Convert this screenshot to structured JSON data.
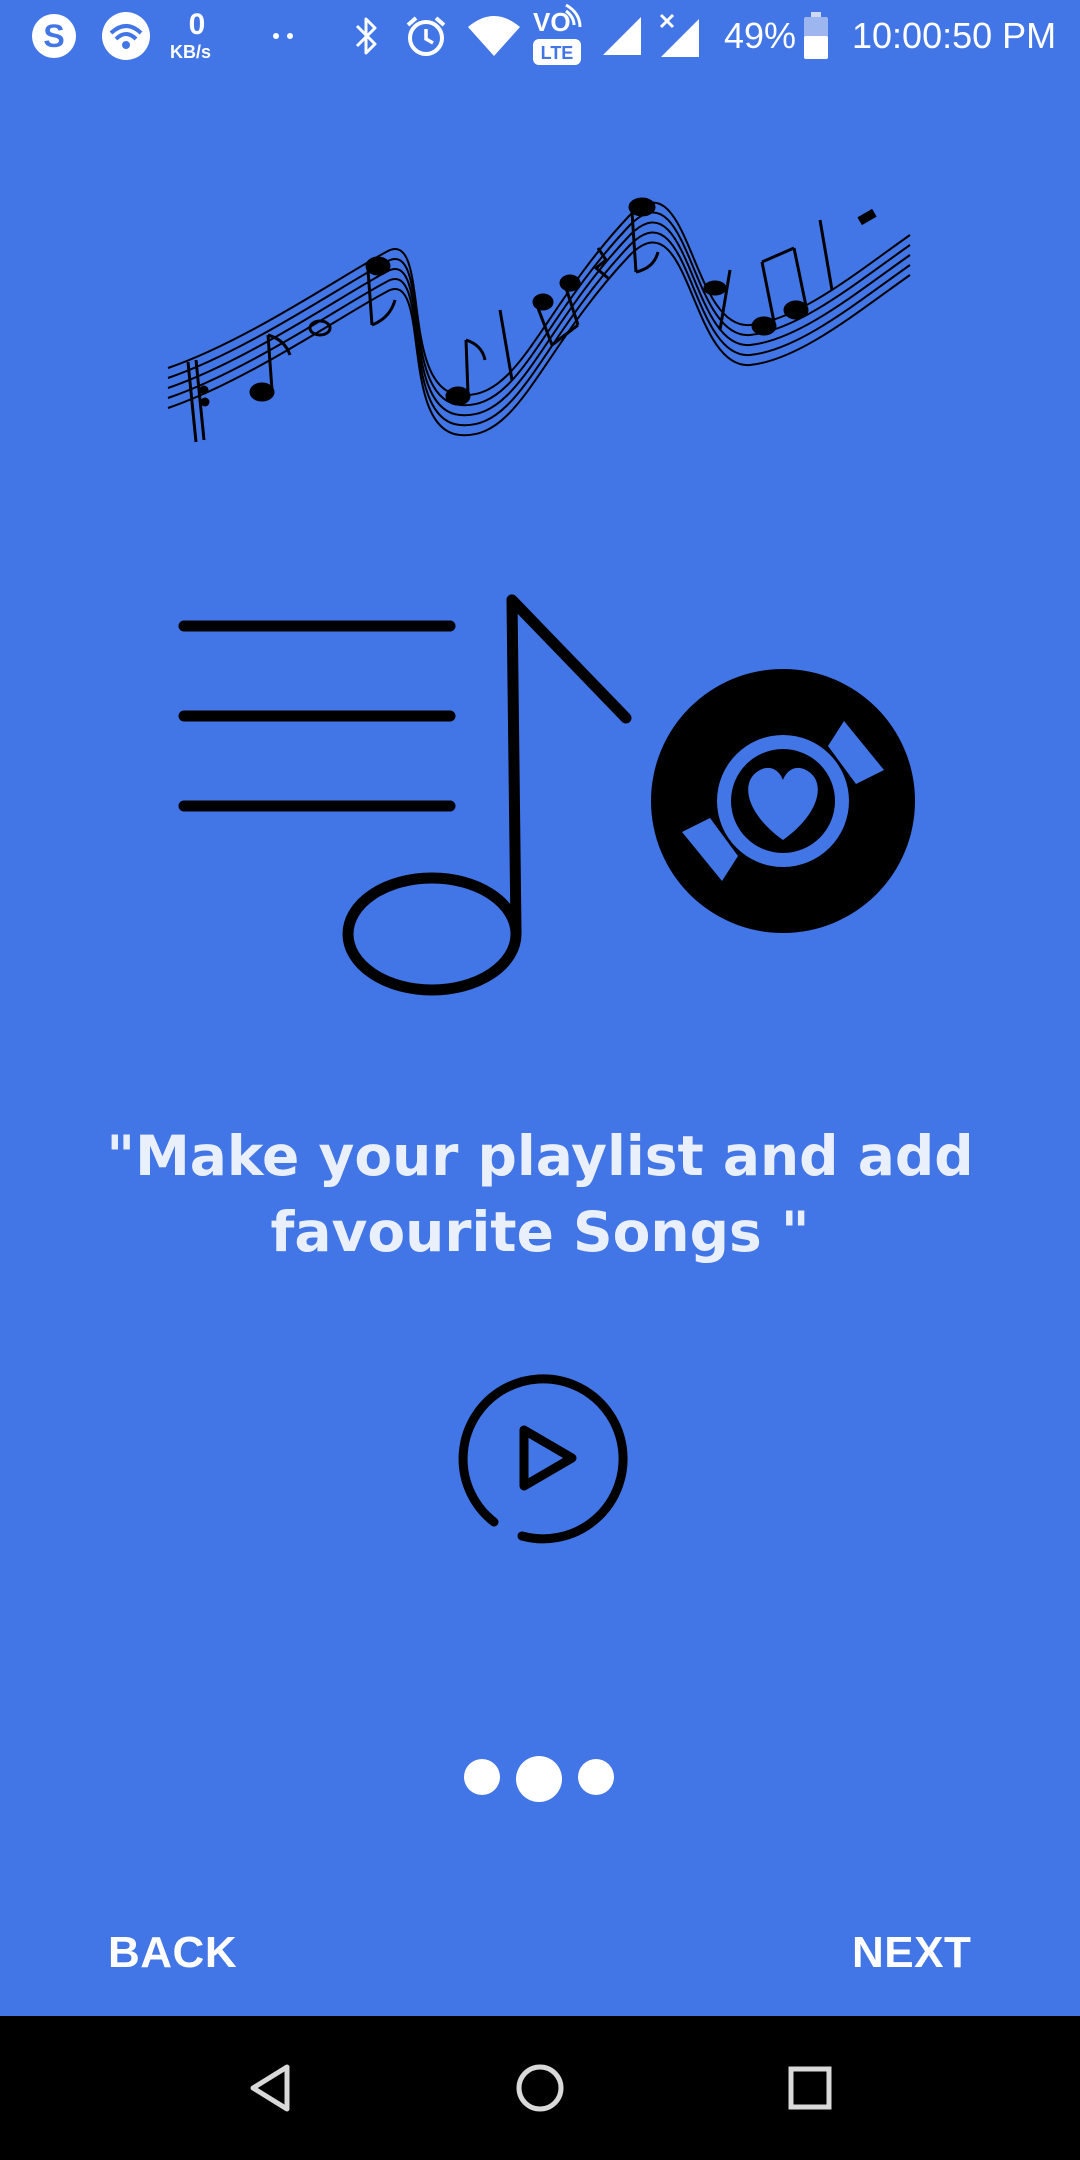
{
  "status_bar": {
    "network_speed_value": "0",
    "network_speed_unit": "KB/s",
    "battery_percent": "49%",
    "time": "10:00:50 PM",
    "volte_label": "VO",
    "lte_label": "LTE",
    "icons": [
      "skype-icon",
      "wifi-hotspot-icon",
      "more-notifications-icon",
      "bluetooth-icon",
      "alarm-icon",
      "wifi-icon",
      "volte-icon",
      "signal-icon",
      "signal-no-data-icon",
      "battery-icon"
    ]
  },
  "onboarding": {
    "headline": "\"Make your playlist and add favourite Songs \"",
    "page_indicator": {
      "total": 3,
      "current": 2
    },
    "illustrations": [
      "music-staff-icon",
      "playlist-icon",
      "vinyl-heart-icon",
      "play-circle-icon"
    ]
  },
  "footer": {
    "back_label": "BACK",
    "next_label": "NEXT"
  },
  "system_nav": {
    "buttons": [
      "back-triangle-icon",
      "home-circle-icon",
      "recents-square-icon"
    ]
  },
  "colors": {
    "background": "#4275e5",
    "foreground": "#ffffff",
    "illustration": "#000000",
    "nav_bar": "#000000"
  }
}
